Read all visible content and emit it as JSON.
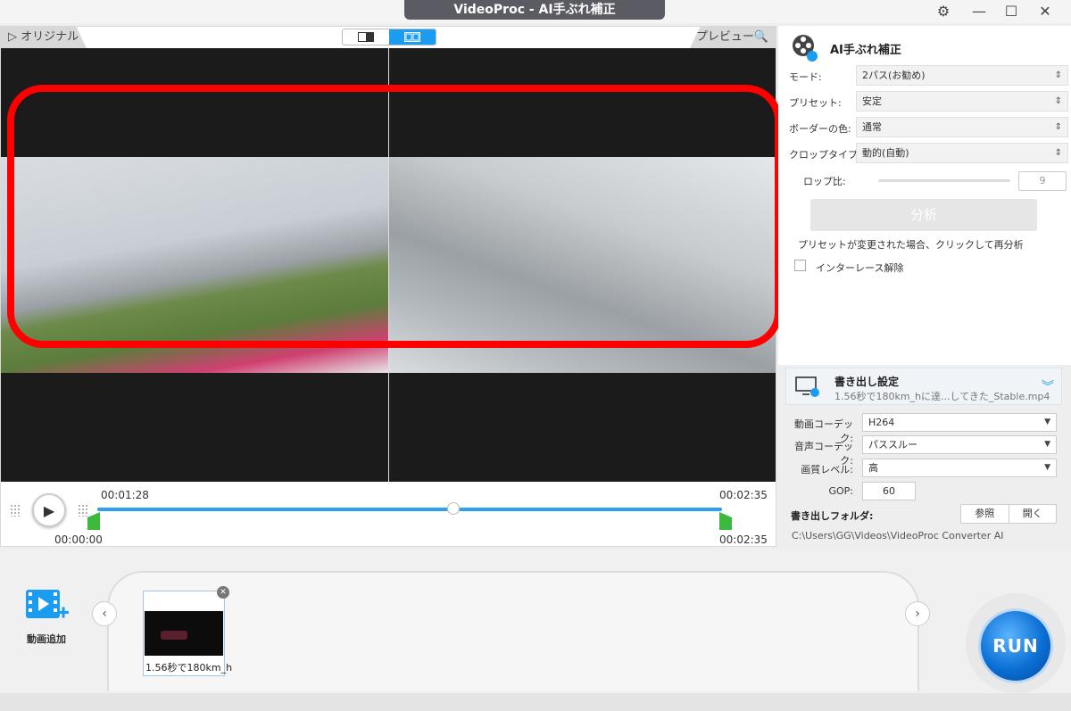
{
  "window": {
    "title": "VideoProc - AI手ぶれ補正",
    "controls": [
      "settings-icon",
      "minimize-icon",
      "maximize-icon",
      "close-icon"
    ]
  },
  "preview": {
    "tab_original": "▷ オリジナル",
    "tab_preview": "プレビュー🔍",
    "controls": {
      "current_time": "00:01:28",
      "start_time": "00:00:00",
      "end_time_top": "00:02:35",
      "end_time_bottom": "00:02:35",
      "playhead_position": 0.57
    }
  },
  "stabilize_panel": {
    "title": "AI手ぶれ補正",
    "rows": [
      {
        "label": "モード:",
        "value": "2パス(お勧め)"
      },
      {
        "label": "プリセット:",
        "value": "安定"
      },
      {
        "label": "ボーダーの色:",
        "value": "通常"
      },
      {
        "label": "クロップタイプ:",
        "value": "動的(自動)"
      }
    ],
    "crop_ratio_label": "ロップ比:",
    "crop_ratio_value": "9",
    "analyze_button": "分析",
    "note": "プリセットが変更された場合、クリックして再分析",
    "deinterlace_label": "インターレース解除"
  },
  "export": {
    "title": "書き出し設定",
    "filename": "1.56秒で180km_hに達...してきた_Stable.mp4",
    "video_codec_label": "動画コーデック:",
    "video_codec": "H264",
    "audio_codec_label": "音声コーデック:",
    "audio_codec": "パススルー",
    "quality_label": "画質レベル:",
    "quality": "高",
    "gop_label": "GOP:",
    "gop": "60",
    "folder_label": "書き出しフォルダ:",
    "browse_button": "参照",
    "open_button": "開く",
    "folder_path": "C:\\Users\\GG\\Videos\\VideoProc Converter AI"
  },
  "bottom": {
    "add_video_label": "動画追加",
    "clip_name": "1.56秒で180km_h",
    "run_button": "RUN"
  },
  "colors": {
    "accent": "#1a9cf0",
    "highlight": "#ff0000",
    "run": "#0b6fd4",
    "marker": "#3cb83c"
  }
}
